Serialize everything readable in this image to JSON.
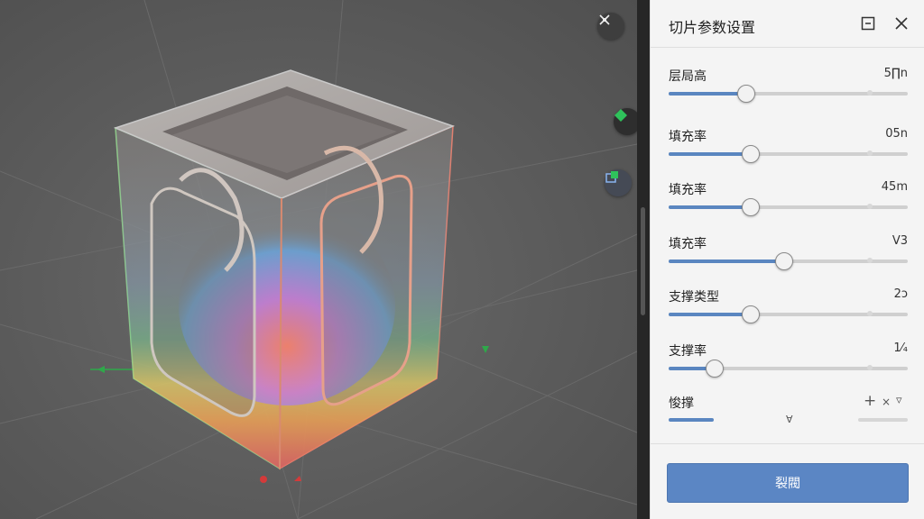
{
  "panel": {
    "title": "切片参数设置",
    "icons": {
      "minimize": "minimize-square-icon",
      "close": "close-icon"
    },
    "sliders": [
      {
        "label": "层局高",
        "value": "5∏n",
        "fraction": 0.32
      },
      {
        "label": "填充率",
        "value": "05n",
        "fraction": 0.34
      },
      {
        "label": "填充率",
        "value": "45m",
        "fraction": 0.34
      },
      {
        "label": "填充率",
        "value": "Ⅴ3",
        "fraction": 0.48
      },
      {
        "label": "支撑类型",
        "value": "2ɔ",
        "fraction": 0.34
      },
      {
        "label": "支撑率",
        "value": "1⁄₄",
        "fraction": 0.19
      }
    ],
    "partial_row": {
      "label": "悛撑",
      "plus": "+",
      "mult": "×",
      "chevron": "▿",
      "mid_mark": "∀"
    },
    "action_label": "裂閥"
  },
  "viewport": {
    "tools": [
      "compass-icon",
      "green-diamond-icon",
      "layers-icon"
    ]
  },
  "colors": {
    "accent": "#5b86c4",
    "panel_bg": "#f4f4f4",
    "viewport_bg": "#5f5f5f"
  }
}
